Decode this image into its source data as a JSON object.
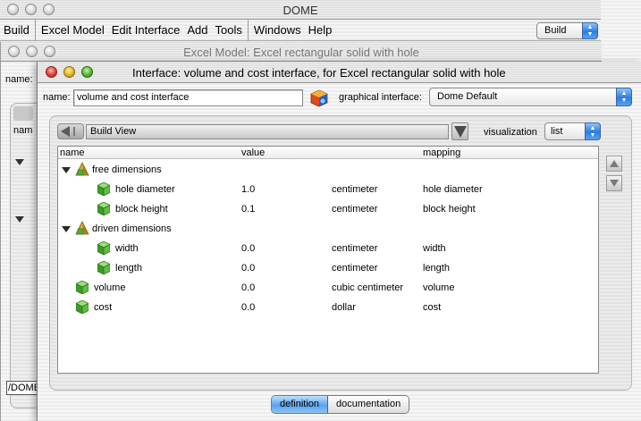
{
  "dome": {
    "title": "DOME",
    "menu": [
      "Build",
      "Excel Model",
      "Edit Interface",
      "Add",
      "Tools",
      "Windows",
      "Help"
    ],
    "mode_select": "Build"
  },
  "model_window": {
    "title": "Excel Model: Excel rectangular solid with hole",
    "name_label": "name:",
    "column_name": "nam",
    "status": "/DOME"
  },
  "interface_window": {
    "title": "Interface: volume and cost interface, for Excel rectangular solid with hole",
    "name_label": "name:",
    "name_value": "volume and cost interface",
    "graphical_label": "graphical interface:",
    "graphical_value": "Dome Default",
    "view_name": "Build View",
    "visualization_label": "visualization",
    "visualization_value": "list",
    "columns": {
      "name": "name",
      "value": "value",
      "mapping": "mapping"
    },
    "rows": [
      {
        "kind": "group",
        "level": 0,
        "name": "free dimensions",
        "value": "",
        "unit": "",
        "mapping": ""
      },
      {
        "kind": "param",
        "level": 1,
        "name": "hole diameter",
        "value": "1.0",
        "unit": "centimeter",
        "mapping": "hole diameter"
      },
      {
        "kind": "param",
        "level": 1,
        "name": "block height",
        "value": "0.1",
        "unit": "centimeter",
        "mapping": "block height"
      },
      {
        "kind": "group",
        "level": 0,
        "name": "driven dimensions",
        "value": "",
        "unit": "",
        "mapping": ""
      },
      {
        "kind": "param",
        "level": 1,
        "name": "width",
        "value": "0.0",
        "unit": "centimeter",
        "mapping": "width"
      },
      {
        "kind": "param",
        "level": 1,
        "name": "length",
        "value": "0.0",
        "unit": "centimeter",
        "mapping": "length"
      },
      {
        "kind": "param",
        "level": 0,
        "name": "volume",
        "value": "0.0",
        "unit": "cubic centimeter",
        "mapping": "volume"
      },
      {
        "kind": "param",
        "level": 0,
        "name": "cost",
        "value": "0.0",
        "unit": "dollar",
        "mapping": "cost"
      }
    ],
    "tabs": [
      {
        "label": "definition",
        "active": true
      },
      {
        "label": "documentation",
        "active": false
      }
    ]
  },
  "colors": {
    "aqua_blue": "#2a7de0",
    "parameter_cube": "#4caf3a",
    "group_bag": "#c8a020"
  },
  "icons": [
    "back-arrow-icon",
    "dropdown-triangle-icon",
    "dome-logo-icon",
    "parameter-cube-icon",
    "filter-group-icon",
    "scroll-up-icon",
    "scroll-down-icon"
  ]
}
